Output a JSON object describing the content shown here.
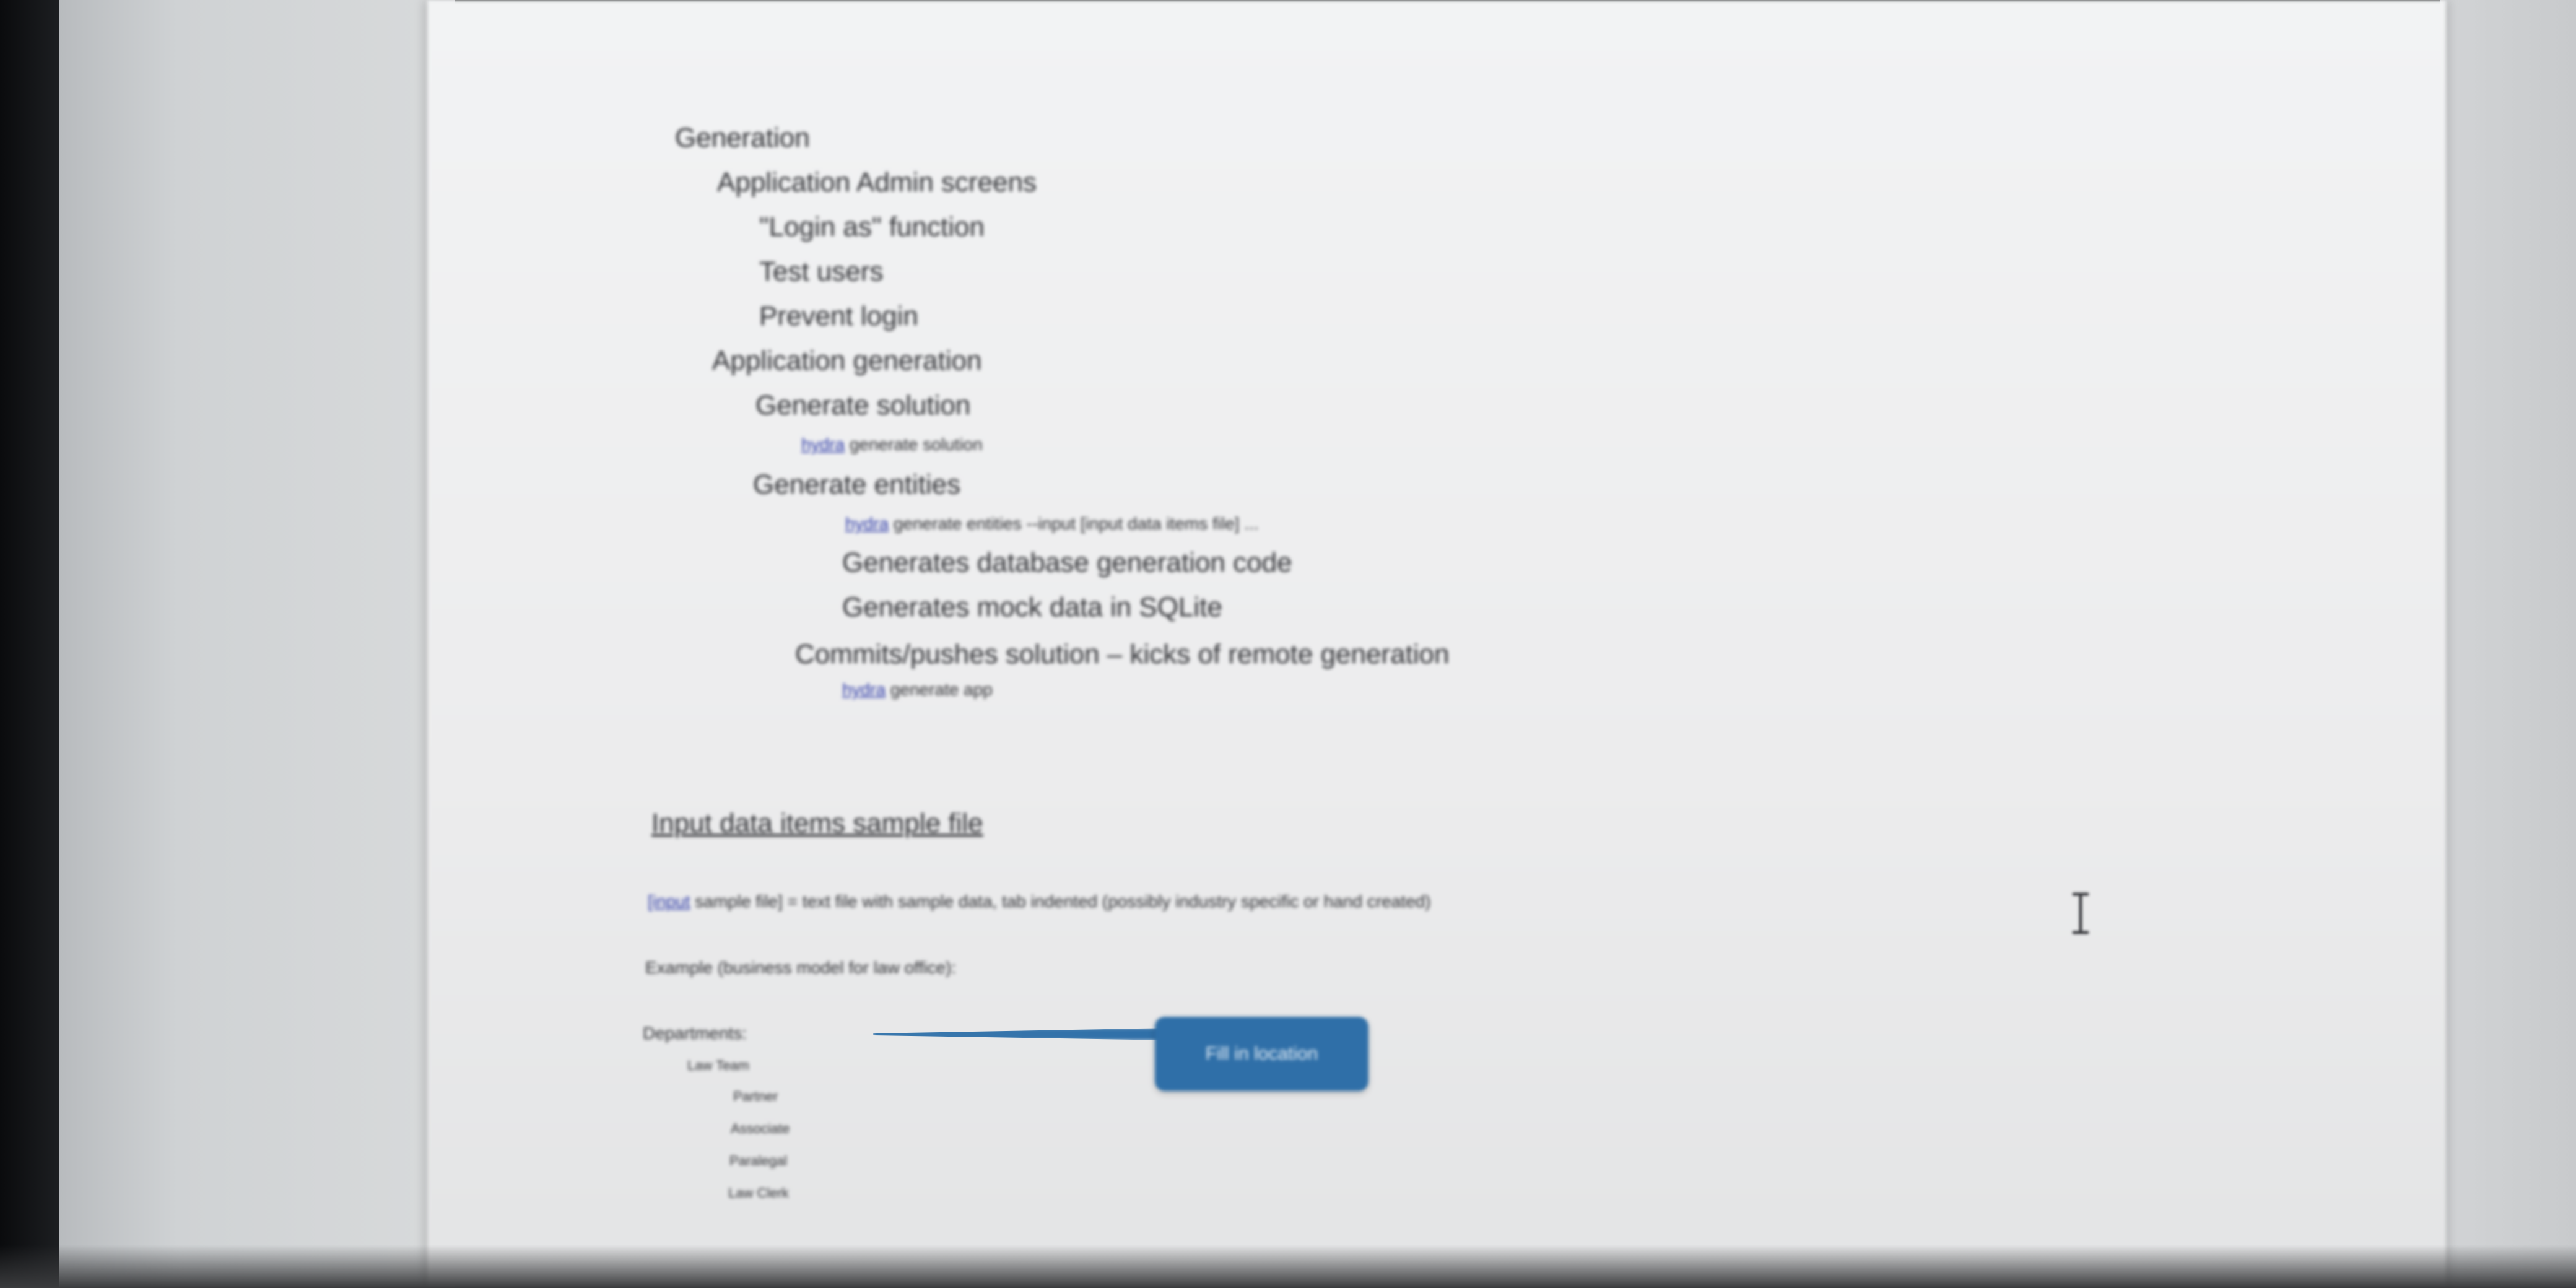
{
  "outline": {
    "generation": "Generation",
    "admin_screens": "Application Admin screens",
    "login_as": "\"Login as\" function",
    "test_users": "Test users",
    "prevent_login": "Prevent login",
    "app_generation": "Application generation",
    "generate_solution": "Generate solution",
    "cmd_gen_solution": {
      "link": "hydra",
      "rest": " generate solution"
    },
    "generate_entities": "Generate entities",
    "cmd_gen_entities": {
      "link": "hydra",
      "rest": " generate entities --input [input data items file] ..."
    },
    "db_code": "Generates database generation code",
    "mock_data": "Generates mock data in SQLite",
    "commits": "Commits/pushes solution – kicks of remote generation",
    "cmd_gen_app": {
      "link": "hydra",
      "rest": " generate app"
    }
  },
  "sample": {
    "heading": "Input data items sample file",
    "desc": {
      "link": "[input",
      "rest": " sample file] = text file with sample data, tab indented (possibly industry specific or hand created)"
    },
    "example": "Example (business model for law office):",
    "tree": {
      "departments": "Departments:",
      "law_team": "Law Team",
      "partner": "Partner",
      "associate": "Associate",
      "paralegal": "Paralegal",
      "law_clerk": "Law Clerk"
    }
  },
  "callout": {
    "label": "Fill in location"
  },
  "colors": {
    "callout": "#2f6fa8",
    "link": "#2d3aa8",
    "text": "#2e2f33"
  },
  "icons": {
    "cursor": "text-cursor-icon"
  }
}
